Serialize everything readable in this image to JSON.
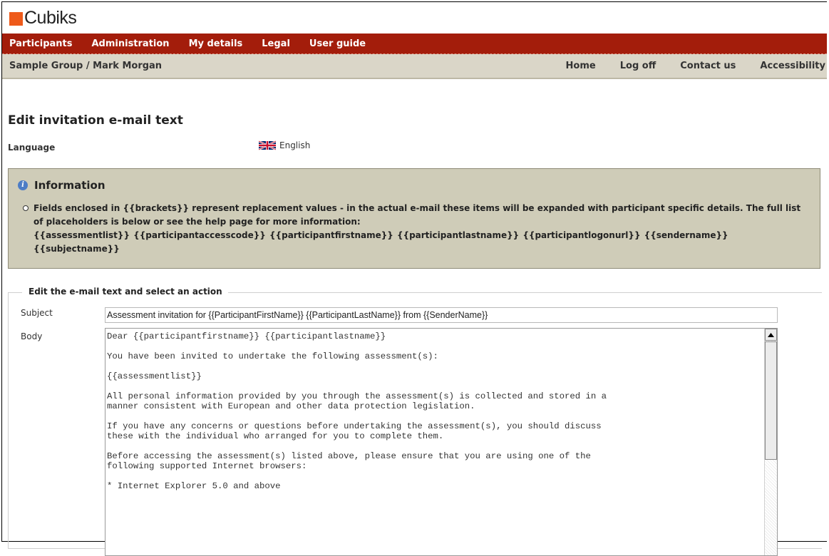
{
  "brand": {
    "name": "Cubiks",
    "mark_color": "#ee5a1a"
  },
  "nav": {
    "items": [
      "Participants",
      "Administration",
      "My details",
      "Legal",
      "User guide"
    ],
    "bg_color": "#a31d0b"
  },
  "breadcrumb": {
    "text": "Sample Group / Mark Morgan"
  },
  "top_links": [
    "Home",
    "Log off",
    "Contact us",
    "Accessibility"
  ],
  "page": {
    "title": "Edit invitation e-mail text",
    "language_label": "Language",
    "language_value": "English",
    "language_icon": "uk-flag-icon"
  },
  "info": {
    "heading": "Information",
    "icon": "info-icon",
    "text": "Fields enclosed in {{brackets}} represent replacement values - in the actual e-mail these items will be expanded with participant specific details. The full list of placeholders is below or see the help page for more information:",
    "placeholders": "{{assessmentlist}} {{participantaccesscode}} {{participantfirstname}} {{participantlastname}} {{participantlogonurl}} {{sendername}} {{subjectname}}"
  },
  "form": {
    "legend": "Edit the e-mail text and select an action",
    "subject_label": "Subject",
    "subject_value": "Assessment invitation for {{ParticipantFirstName}} {{ParticipantLastName}} from {{SenderName}}",
    "body_label": "Body",
    "body_value": "Dear {{participantfirstname}} {{participantlastname}}\n\nYou have been invited to undertake the following assessment(s):\n\n{{assessmentlist}}\n\nAll personal information provided by you through the assessment(s) is collected and stored in a\nmanner consistent with European and other data protection legislation.\n\nIf you have any concerns or questions before undertaking the assessment(s), you should discuss\nthese with the individual who arranged for you to complete them.\n\nBefore accessing the assessment(s) listed above, please ensure that you are using one of the\nfollowing supported Internet browsers:\n\n* Internet Explorer 5.0 and above"
  }
}
